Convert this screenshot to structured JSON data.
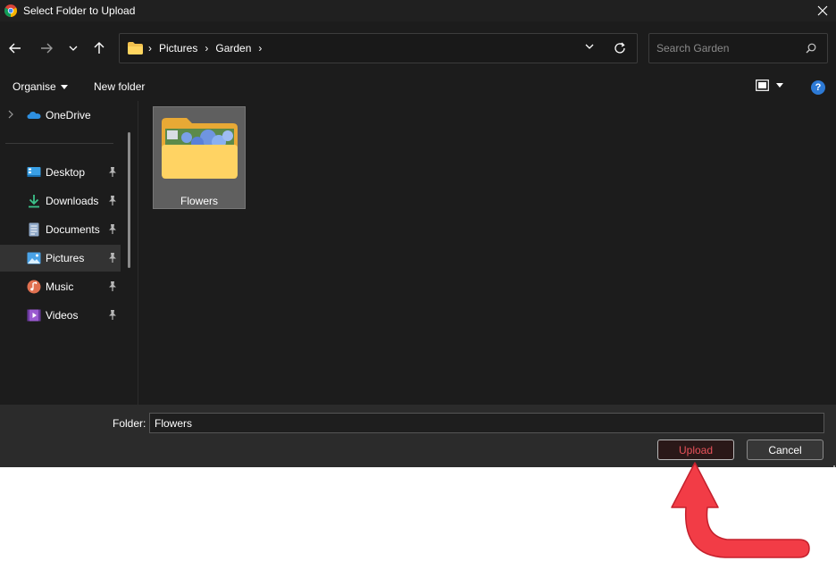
{
  "window": {
    "title": "Select Folder to Upload",
    "close_glyph": "✕"
  },
  "address": {
    "crumbs": [
      "Pictures",
      "Garden"
    ],
    "separator": "›"
  },
  "search": {
    "placeholder": "Search Garden"
  },
  "commands": {
    "organise": "Organise",
    "new_folder": "New folder",
    "help": "?"
  },
  "sidebar": {
    "items": [
      {
        "label": "OneDrive",
        "icon": "onedrive-icon"
      },
      {
        "label": "Desktop",
        "icon": "desktop-icon",
        "pinned": true
      },
      {
        "label": "Downloads",
        "icon": "downloads-icon",
        "pinned": true
      },
      {
        "label": "Documents",
        "icon": "documents-icon",
        "pinned": true
      },
      {
        "label": "Pictures",
        "icon": "pictures-icon",
        "pinned": true,
        "selected": true
      },
      {
        "label": "Music",
        "icon": "music-icon",
        "pinned": true
      },
      {
        "label": "Videos",
        "icon": "videos-icon",
        "pinned": true
      }
    ]
  },
  "content": {
    "items": [
      {
        "name": "Flowers",
        "type": "folder",
        "selected": true
      }
    ]
  },
  "footer": {
    "folder_label": "Folder:",
    "folder_value": "Flowers",
    "upload_label": "Upload",
    "cancel_label": "Cancel"
  },
  "colors": {
    "dialog_bg": "#1c1c1c",
    "accent_red": "#e8525a",
    "annotation_arrow": "#f23c46"
  }
}
